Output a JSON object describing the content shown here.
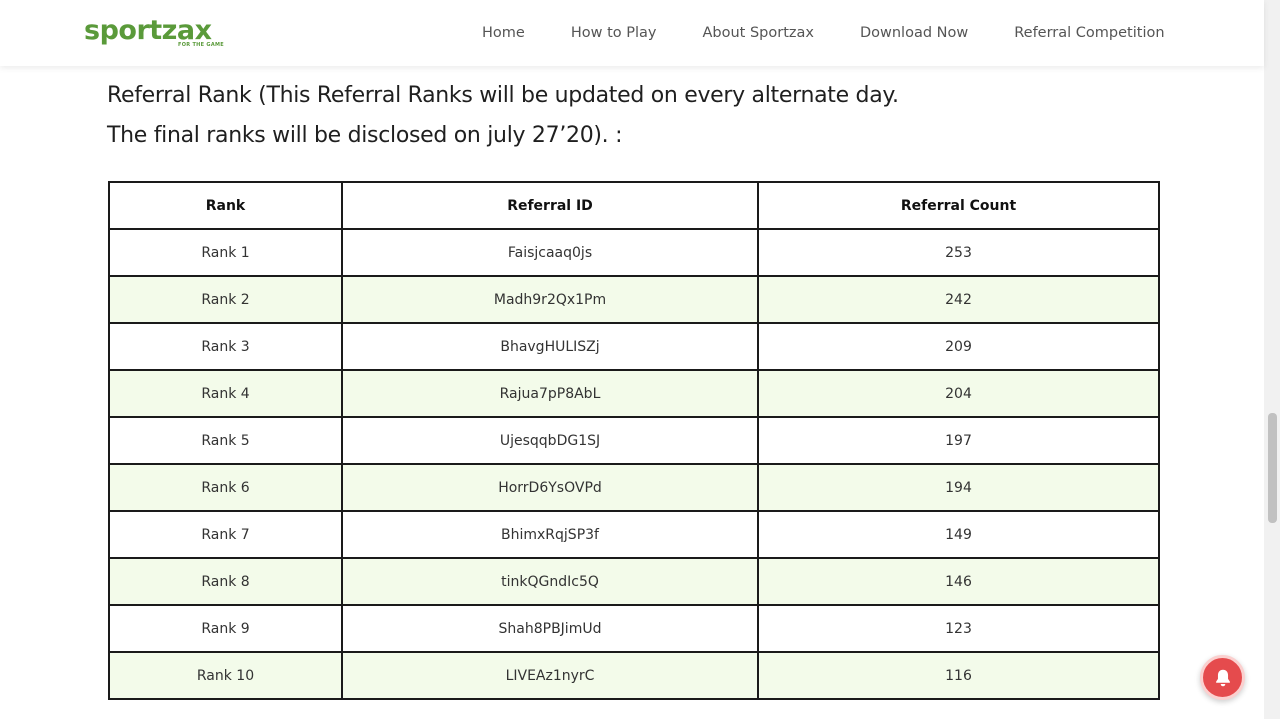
{
  "brand": {
    "logo_text": "sportzax",
    "tagline": "FOR THE GAME",
    "color": "#5a9a3a"
  },
  "nav": {
    "items": [
      {
        "label": "Home"
      },
      {
        "label": "How to Play"
      },
      {
        "label": "About Sportzax"
      },
      {
        "label": "Download Now"
      },
      {
        "label": "Referral Competition"
      }
    ]
  },
  "headline": {
    "line1": "Referral Rank (This Referral Ranks will be updated on every alternate day.",
    "line2": "The final ranks will be disclosed on july 27’20). :"
  },
  "table": {
    "headers": [
      "Rank",
      "Referral ID",
      "Referral Count"
    ],
    "rows": [
      [
        "Rank 1",
        "Faisjcaaq0js",
        "253"
      ],
      [
        "Rank 2",
        "Madh9r2Qx1Pm",
        "242"
      ],
      [
        "Rank 3",
        "BhavgHULISZj",
        "209"
      ],
      [
        "Rank 4",
        "Rajua7pP8AbL",
        "204"
      ],
      [
        "Rank 5",
        "UjesqqbDG1SJ",
        "197"
      ],
      [
        "Rank 6",
        "HorrD6YsOVPd",
        "194"
      ],
      [
        "Rank 7",
        "BhimxRqjSP3f",
        "149"
      ],
      [
        "Rank 8",
        "tinkQGndIc5Q",
        "146"
      ],
      [
        "Rank 9",
        "Shah8PBJimUd",
        "123"
      ],
      [
        "Rank 10",
        "LIVEAz1nyrC",
        "116"
      ]
    ],
    "stripe_color": "#f3fbea"
  },
  "notification": {
    "icon": "bell-icon",
    "color": "#e54b4d"
  }
}
